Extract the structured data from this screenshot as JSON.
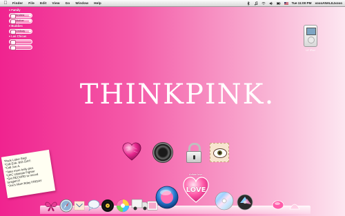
{
  "menubar": {
    "apple_icon": "apple-logo-icon",
    "menus": [
      "Finder",
      "File",
      "Edit",
      "View",
      "Go",
      "Window",
      "Help"
    ],
    "clock": "Tue 11:00 PM",
    "user": "xoxoANALILIxoxo",
    "status_icons": [
      "bluetooth-icon",
      "music-note-icon",
      "wifi-icon",
      "volume-icon",
      "battery-icon",
      "flag-icon"
    ]
  },
  "buddy_list": {
    "groups": [
      {
        "label": "Family",
        "buddies": [
          "Andrea",
          "Mother"
        ]
      },
      {
        "label": "Buddies",
        "buddies": [
          "Lindsay"
        ]
      },
      {
        "label": "Las Chicas",
        "buddies": [
          "",
          ""
        ]
      }
    ]
  },
  "desktop": {
    "ipod_label": "Lil' iPod",
    "wordmark": "THINKPINK."
  },
  "sticky_note": {
    "lines": [
      "*Pack Labor Bag!",
      "*Call Erik- BIG DAY!",
      "*Call Joe A.",
      "*Take more belly pics",
      "*UFC Ultimate Fighter",
      "*Set RECORD to record",
      "  tonight!!!!!",
      "*Joe's Mom Bday FRIDAY"
    ]
  },
  "center_icons": [
    "pink-heart-icon",
    "camera-lens-icon",
    "padlock-icon",
    "eye-stamp-icon"
  ],
  "dock": {
    "love_caption": "Adium love",
    "love_text": "LOVE",
    "items": [
      "butterfly-icon",
      "compass-safari-icon",
      "mail-stamp-icon",
      "chat-bubble-icon",
      "record-player-icon",
      "color-wheel-icon",
      "moving-truck-icon",
      "photo-icon",
      "dashboard-orb-icon",
      "love-heart-icon",
      "cd-disc-icon",
      "dvd-disc-icon",
      "pink-orb-icon",
      "pink-shell-icon",
      "trash-icon"
    ]
  },
  "colors": {
    "pink_deep": "#f0238f",
    "pink_light": "#fde7f1",
    "white": "#ffffff"
  }
}
